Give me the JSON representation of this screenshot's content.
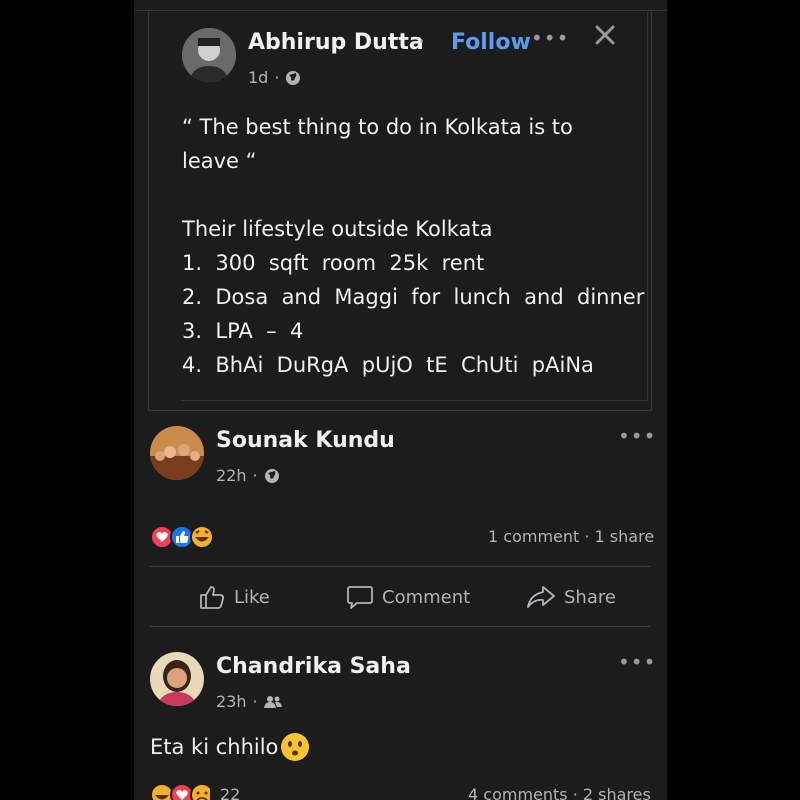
{
  "shared_post": {
    "author": "Abhirup Dutta",
    "dot": "·",
    "follow_label": "Follow",
    "time": "1d",
    "visibility_icon": "globe-icon",
    "text": "“ The best thing to do in Kolkata is to\nleave “\n\nTheir lifestyle outside Kolkata\n1.  300  sqft  room  25k  rent\n2.  Dosa  and  Maggi  for  lunch  and  dinner\n3.  LPA  –  4\n4.  BhAi  DuRgA  pUjO  tE  ChUti  pAiNa"
  },
  "post1": {
    "author": "Sounak Kundu",
    "time": "22h",
    "visibility_icon": "globe-icon",
    "reactions": [
      "love",
      "like",
      "haha"
    ],
    "stats": "1 comment · 1 share",
    "actions": {
      "like": "Like",
      "comment": "Comment",
      "share": "Share"
    }
  },
  "post2": {
    "author": "Chandrika Saha",
    "time": "23h",
    "visibility_icon": "friends-icon",
    "text": "Eta ki chhilo",
    "reaction_count": "22",
    "stats": "4 comments · 2 shares"
  },
  "colors": {
    "background": "#1c1c1c",
    "link": "#5b9cf0",
    "like": "#1877f2",
    "love": "#f33e58",
    "haha": "#f7b125"
  }
}
